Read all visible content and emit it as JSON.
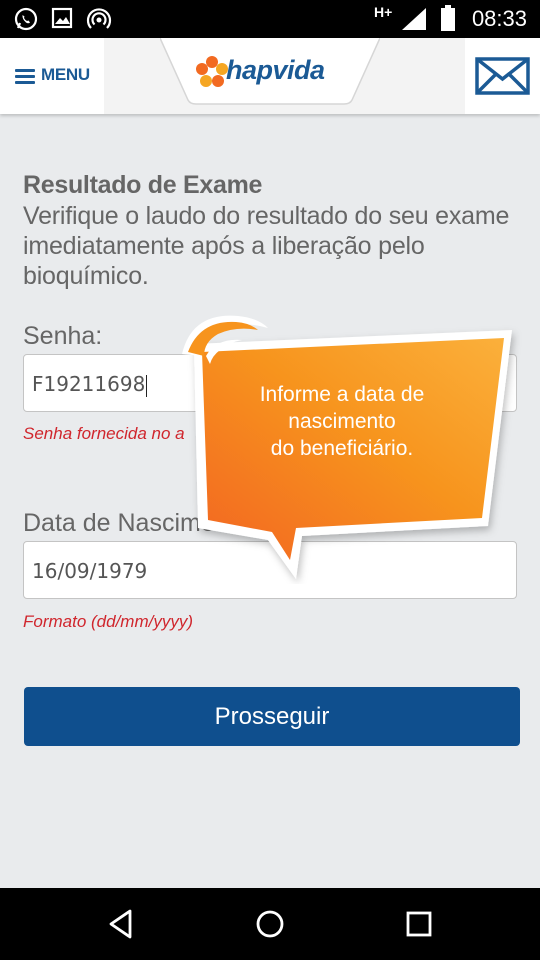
{
  "status_bar": {
    "time": "08:33",
    "network": "H+",
    "icons": [
      "whatsapp-icon",
      "image-icon",
      "hotspot-icon",
      "signal-icon",
      "battery-icon"
    ]
  },
  "header": {
    "menu_label": "MENU",
    "logo_text": "hapvida",
    "icons": [
      "menu-icon",
      "logo-flower-icon",
      "mail-icon"
    ]
  },
  "main": {
    "title": "Resultado de Exame",
    "description": "Verifique o laudo do resultado do seu exame imediatamente após a liberação pelo bioquímico.",
    "senha": {
      "label": "Senha:",
      "value": "F19211698",
      "hint": "Senha fornecida no a"
    },
    "data_nascimento": {
      "label": "Data de Nascimento",
      "value": "16/09/1979",
      "hint": "Formato (dd/mm/yyyy)"
    },
    "submit_label": "Prosseguir"
  },
  "tooltip": {
    "line1": "Informe a data de",
    "line2": "nascimento",
    "line3": "do beneficiário."
  },
  "colors": {
    "brand_blue": "#1b5a95",
    "button_blue": "#0f4f8e",
    "hint_red": "#d0262d",
    "tooltip_orange": "#f7941d"
  },
  "nav_bar": {
    "icons": [
      "back-icon",
      "home-icon",
      "recents-icon"
    ]
  }
}
